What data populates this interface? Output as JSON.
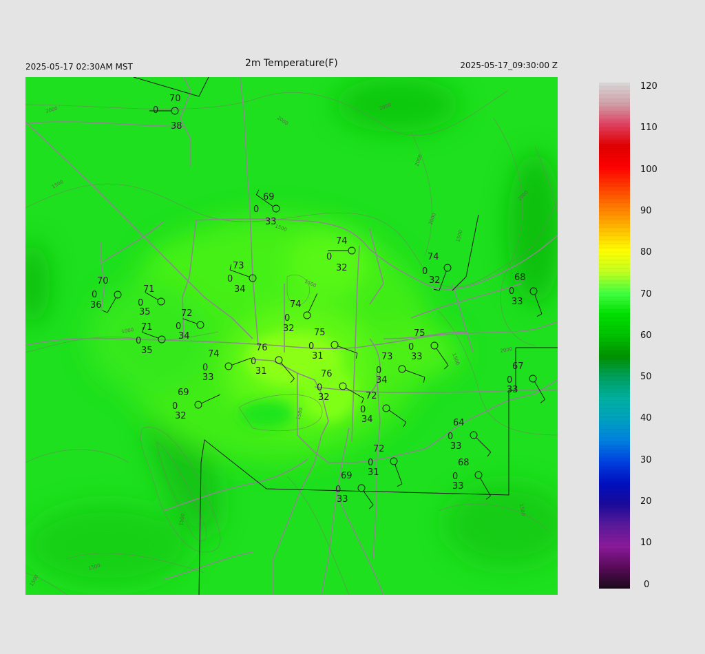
{
  "header": {
    "local_time": "2025-05-17 02:30AM MST",
    "title": "2m Temperature(F)",
    "utc_time": "2025-05-17_09:30:00 Z"
  },
  "colorbar": {
    "min": 0,
    "max": 120,
    "labels": [
      "120",
      "110",
      "100",
      "90",
      "80",
      "70",
      "60",
      "50",
      "40",
      "30",
      "20",
      "10",
      "0"
    ],
    "colors": [
      "#1a0a1a",
      "#5a0a5a",
      "#8a1a9a",
      "#5a1a9a",
      "#1a0a9a",
      "#0010c0",
      "#0040e0",
      "#0080e0",
      "#00a0c0",
      "#00b0a0",
      "#00a060",
      "#009000",
      "#00c000",
      "#00e000",
      "#40ff40",
      "#c0ff20",
      "#ffff00",
      "#ffc000",
      "#ff8000",
      "#ff4000",
      "#ff0000",
      "#e00000",
      "#e04060",
      "#d0a0a8",
      "#d8d8d8"
    ]
  },
  "contours": [
    "2000",
    "1500",
    "1000",
    "1500",
    "2000",
    "2000",
    "1500",
    "1500",
    "1500",
    "2000",
    "1500",
    "1500",
    "1500",
    "1500",
    "1500",
    "1500"
  ],
  "stations": [
    {
      "temp": "70",
      "dew": "38",
      "calm": "0",
      "wx": "0",
      "wy": 0.05
    },
    {
      "temp": "69",
      "dew": "33",
      "calm": "0"
    },
    {
      "temp": "74",
      "dew": "32",
      "calm": "0"
    },
    {
      "temp": "74",
      "dew": "32",
      "calm": "0"
    },
    {
      "temp": "73",
      "dew": "34",
      "calm": "0"
    },
    {
      "temp": "68",
      "dew": "33",
      "calm": "0"
    },
    {
      "temp": "70",
      "dew": "36",
      "calm": "0"
    },
    {
      "temp": "71",
      "dew": "35",
      "calm": "0"
    },
    {
      "temp": "74",
      "dew": "32",
      "calm": "0"
    },
    {
      "temp": "72",
      "dew": "34",
      "calm": "0"
    },
    {
      "temp": "71",
      "dew": "35",
      "calm": "0"
    },
    {
      "temp": "75",
      "dew": "31",
      "calm": "0"
    },
    {
      "temp": "75",
      "dew": "33",
      "calm": "0"
    },
    {
      "temp": "76",
      "dew": "31",
      "calm": "0"
    },
    {
      "temp": "74",
      "dew": "33",
      "calm": "0"
    },
    {
      "temp": "73",
      "dew": "34",
      "calm": "0"
    },
    {
      "temp": "67",
      "dew": "33",
      "calm": "0"
    },
    {
      "temp": "76",
      "dew": "32",
      "calm": "0"
    },
    {
      "temp": "69",
      "dew": "32",
      "calm": "0"
    },
    {
      "temp": "72",
      "dew": "34",
      "calm": "0"
    },
    {
      "temp": "64",
      "dew": "33",
      "calm": "0"
    },
    {
      "temp": "72",
      "dew": "31",
      "calm": "0"
    },
    {
      "temp": "68",
      "dew": "33",
      "calm": "0"
    },
    {
      "temp": "69",
      "dew": "33",
      "calm": "0"
    }
  ]
}
